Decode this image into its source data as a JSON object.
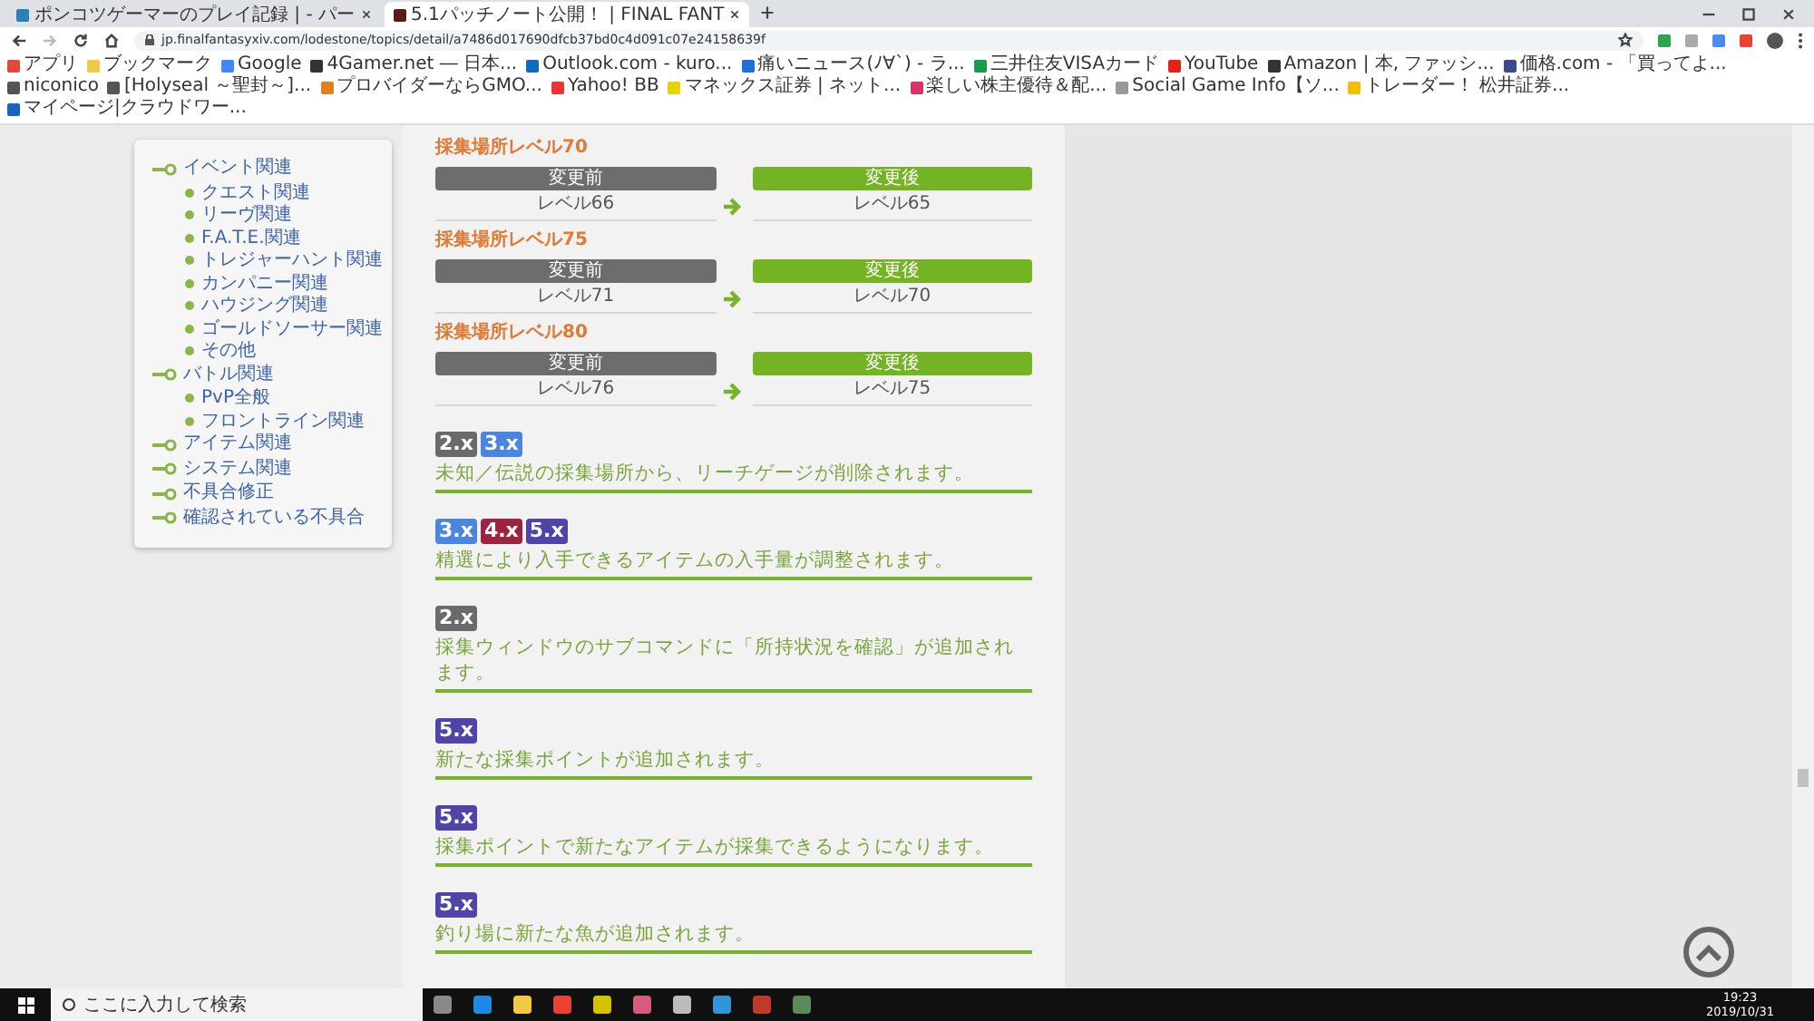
{
  "browser": {
    "tabs": [
      {
        "title": "ポンコツゲーマーのプレイ記録 | - パー",
        "selected": false
      },
      {
        "title": "5.1パッチノート公開！ | FINAL FANT",
        "selected": true
      }
    ],
    "address": "jp.finalfantasyxiv.com/lodestone/topics/detail/a7486d017690dfcb37bd0c4d091c07e24158639f",
    "bookmarks": [
      "アプリ",
      "ブックマーク",
      "Google",
      "4Gamer.net ― 日本...",
      "Outlook.com - kuro...",
      "痛いニュース(ﾉ∀`) - ラ...",
      "三井住友VISAカード",
      "YouTube",
      "Amazon | 本, ファッシ...",
      "価格.com - 「買ってよ...",
      "niconico",
      "[Holyseal ～聖封～]...",
      "プロバイダーならGMO...",
      "Yahoo! BB",
      "マネックス証券 | ネット...",
      "楽しい株主優待＆配...",
      "Social Game Info【ソ...",
      "トレーダー！ 松井証券...",
      "マイページ|クラウドワー..."
    ]
  },
  "sidebar": {
    "items": [
      {
        "label": "イベント関連",
        "children": [
          {
            "label": "クエスト関連"
          },
          {
            "label": "リーヴ関連"
          },
          {
            "label": "F.A.T.E.関連"
          },
          {
            "label": "トレジャーハント関連"
          },
          {
            "label": "カンパニー関連"
          },
          {
            "label": "ハウジング関連"
          },
          {
            "label": "ゴールドソーサー関連"
          },
          {
            "label": "その他"
          }
        ]
      },
      {
        "label": "バトル関連",
        "children": [
          {
            "label": "PvP全般"
          },
          {
            "label": "フロントライン関連"
          }
        ]
      },
      {
        "label": "アイテム関連"
      },
      {
        "label": "システム関連"
      },
      {
        "label": "不具合修正"
      },
      {
        "label": "確認されている不具合"
      }
    ]
  },
  "level_changes": [
    {
      "title": "採集場所レベル70",
      "before_label": "変更前",
      "after_label": "変更後",
      "before": "レベル66",
      "after": "レベル65"
    },
    {
      "title": "採集場所レベル75",
      "before_label": "変更前",
      "after_label": "変更後",
      "before": "レベル71",
      "after": "レベル70"
    },
    {
      "title": "採集場所レベル80",
      "before_label": "変更前",
      "after_label": "変更後",
      "before": "レベル76",
      "after": "レベル75"
    }
  ],
  "notes": [
    {
      "badges": [
        {
          "label": "2.x",
          "color": "#6a6a6a"
        },
        {
          "label": "3.x",
          "color": "#4a86e0"
        }
      ],
      "text": "未知／伝説の採集場所から、リーチゲージが削除されます。"
    },
    {
      "badges": [
        {
          "label": "3.x",
          "color": "#4a86e0"
        },
        {
          "label": "4.x",
          "color": "#9e2340"
        },
        {
          "label": "5.x",
          "color": "#4f44a8"
        }
      ],
      "text": "精選により入手できるアイテムの入手量が調整されます。"
    },
    {
      "badges": [
        {
          "label": "2.x",
          "color": "#6a6a6a"
        }
      ],
      "text": "採集ウィンドウのサブコマンドに「所持状況を確認」が追加されます。"
    },
    {
      "badges": [
        {
          "label": "5.x",
          "color": "#4f44a8"
        }
      ],
      "text": "新たな採集ポイントが追加されます。"
    },
    {
      "badges": [
        {
          "label": "5.x",
          "color": "#4f44a8"
        }
      ],
      "text": "採集ポイントで新たなアイテムが採集できるようになります。"
    },
    {
      "badges": [
        {
          "label": "5.x",
          "color": "#4f44a8"
        }
      ],
      "text": "釣り場に新たな魚が追加されます。"
    }
  ],
  "taskbar": {
    "search_placeholder": "ここに入力して検索",
    "time": "19:23",
    "date": "2019/10/31"
  }
}
